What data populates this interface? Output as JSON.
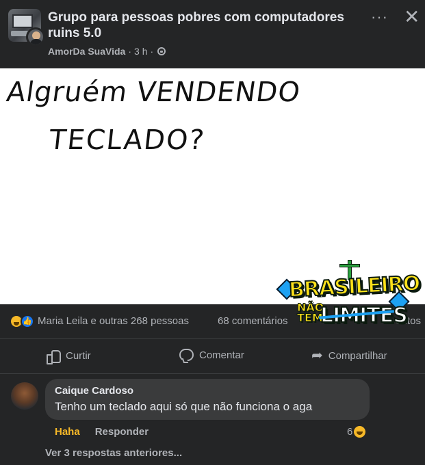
{
  "header": {
    "group_name": "Grupo para pessoas pobres com computadores ruins 5.0",
    "author": "AmorDa SuaVida",
    "time": "3 h",
    "separator": "·",
    "more_icon": "more-horizontal-icon",
    "close_icon": "close-icon"
  },
  "post_image": {
    "handwritten_line1": "Algruém VENDENDO",
    "handwritten_line2": "TECLADO?",
    "watermark": {
      "title": "BRASILEIRO",
      "nao": "NÃO",
      "tem": "TEM",
      "limites": "LIMITES"
    }
  },
  "reactions": {
    "icons": [
      "haha-icon",
      "like-icon"
    ],
    "summary": "Maria Leila e outras 268 pessoas",
    "comments": "68 comentários",
    "shares_partial": "entos"
  },
  "actions": {
    "like": "Curtir",
    "comment": "Comentar",
    "share": "Compartilhar"
  },
  "comment": {
    "author": "Caique Cardoso",
    "text": "Tenho um teclado aqui só que não funciona o aga",
    "reaction_label": "Haha",
    "reply_label": "Responder",
    "reaction_count": "6"
  },
  "view_replies": "Ver 3 respostas anteriores...",
  "colors": {
    "background": "#18191a",
    "surface": "#242526",
    "bubble": "#3a3b3c",
    "text_primary": "#e4e6eb",
    "text_secondary": "#b0b3b8",
    "haha": "#f7b928",
    "like": "#1877f2"
  }
}
